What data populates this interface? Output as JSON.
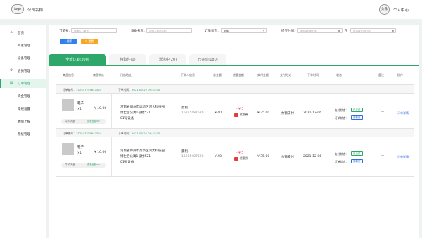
{
  "header": {
    "logo": "logo",
    "company": "公司名称",
    "avatar": "头像",
    "user_center": "个人中心"
  },
  "sidebar": {
    "items": [
      {
        "label": "首页",
        "icon": "home-icon"
      },
      {
        "label": "商家管理",
        "icon": ""
      },
      {
        "label": "设备管理",
        "icon": ""
      },
      {
        "label": "会员管理",
        "icon": "crown-icon"
      },
      {
        "label": "订单管理",
        "icon": "order-icon",
        "active": true
      },
      {
        "label": "资金管理",
        "icon": ""
      },
      {
        "label": "常规设置",
        "icon": ""
      },
      {
        "label": "故障上报",
        "icon": ""
      },
      {
        "label": "系统管理",
        "icon": ""
      }
    ]
  },
  "filters": {
    "order_no_label": "订单号：",
    "order_no_placeholder": "请输入订单号",
    "device_label": "设备名称：",
    "device_placeholder": "请输入商品名称",
    "status_label": "订单状态：",
    "status_value": "全部",
    "time_label": "提交时间：",
    "start_placeholder": "请选择开始时间",
    "sep": "至",
    "end_placeholder": "请选择开始时间",
    "search_btn": "搜索",
    "reset_btn": "重置"
  },
  "tabs": [
    {
      "label": "全部订单(200)",
      "active": true
    },
    {
      "label": "待取件(0)"
    },
    {
      "label": "洗涤中(20)"
    },
    {
      "label": "已完成(180)"
    }
  ],
  "table_headers": [
    "商品信息",
    "商品单价",
    "门店地址",
    "下单人信息",
    "总金额",
    "优惠金额",
    "实付金额",
    "支付方式",
    "下单时间",
    "状态",
    "备注",
    "操作"
  ],
  "orders": [
    {
      "order_no_label": "订单编号：",
      "order_no": "152547255647524",
      "time_label": "下单时间：",
      "time": "2021-09-22  09:41:00",
      "product": "鞋子",
      "qty": "×1",
      "price": "¥ 10.00",
      "address": [
        "河南省郑州市高新区河大科技园",
        "博士后公寓1号楼521",
        "01号设备"
      ],
      "buyer_name": "夏利",
      "buyer_phone": "15265487520",
      "total": "¥ 40",
      "discount": "- ¥ 5",
      "coupon": "优惠券",
      "paid": "¥ 35.00",
      "pay_method": "余额支付",
      "order_date": "2021-12-06",
      "pay_status_label": "支付状态：",
      "pay_status": "已支付",
      "order_status_label": "订单状态：",
      "order_status": "待取货",
      "remark": "---",
      "action": "订单详情",
      "goods_count": "共3件商品",
      "view_all": "查看全部>>"
    },
    {
      "order_no_label": "订单编号：",
      "order_no": "152547255647524",
      "time_label": "下单时间：",
      "time": "2021-09-22  09:41:00",
      "product": "鞋子",
      "qty": "×1",
      "price": "¥ 10.00",
      "address": [
        "河南省郑州市高新区河大科技园",
        "博士后公寓1号楼521",
        "01号设备"
      ],
      "buyer_name": "夏利",
      "buyer_phone": "15265487520",
      "total": "¥ 40",
      "discount": "- ¥ 5",
      "coupon": "优惠券",
      "paid": "¥ 35.00",
      "pay_method": "余额支付",
      "order_date": "2021-12-06",
      "pay_status_label": "支付状态：",
      "pay_status": "已支付",
      "order_status_label": "订单状态：",
      "order_status": "待取货",
      "remark": "---",
      "action": "订单详情",
      "goods_count": "共3件商品",
      "view_all": "查看全部>>"
    }
  ],
  "colors": {
    "accent": "#2ea86a",
    "link": "#2f6fe0",
    "search_btn": "#2f80ed",
    "reset_btn": "#f5a623",
    "discount": "#e23c3c"
  }
}
